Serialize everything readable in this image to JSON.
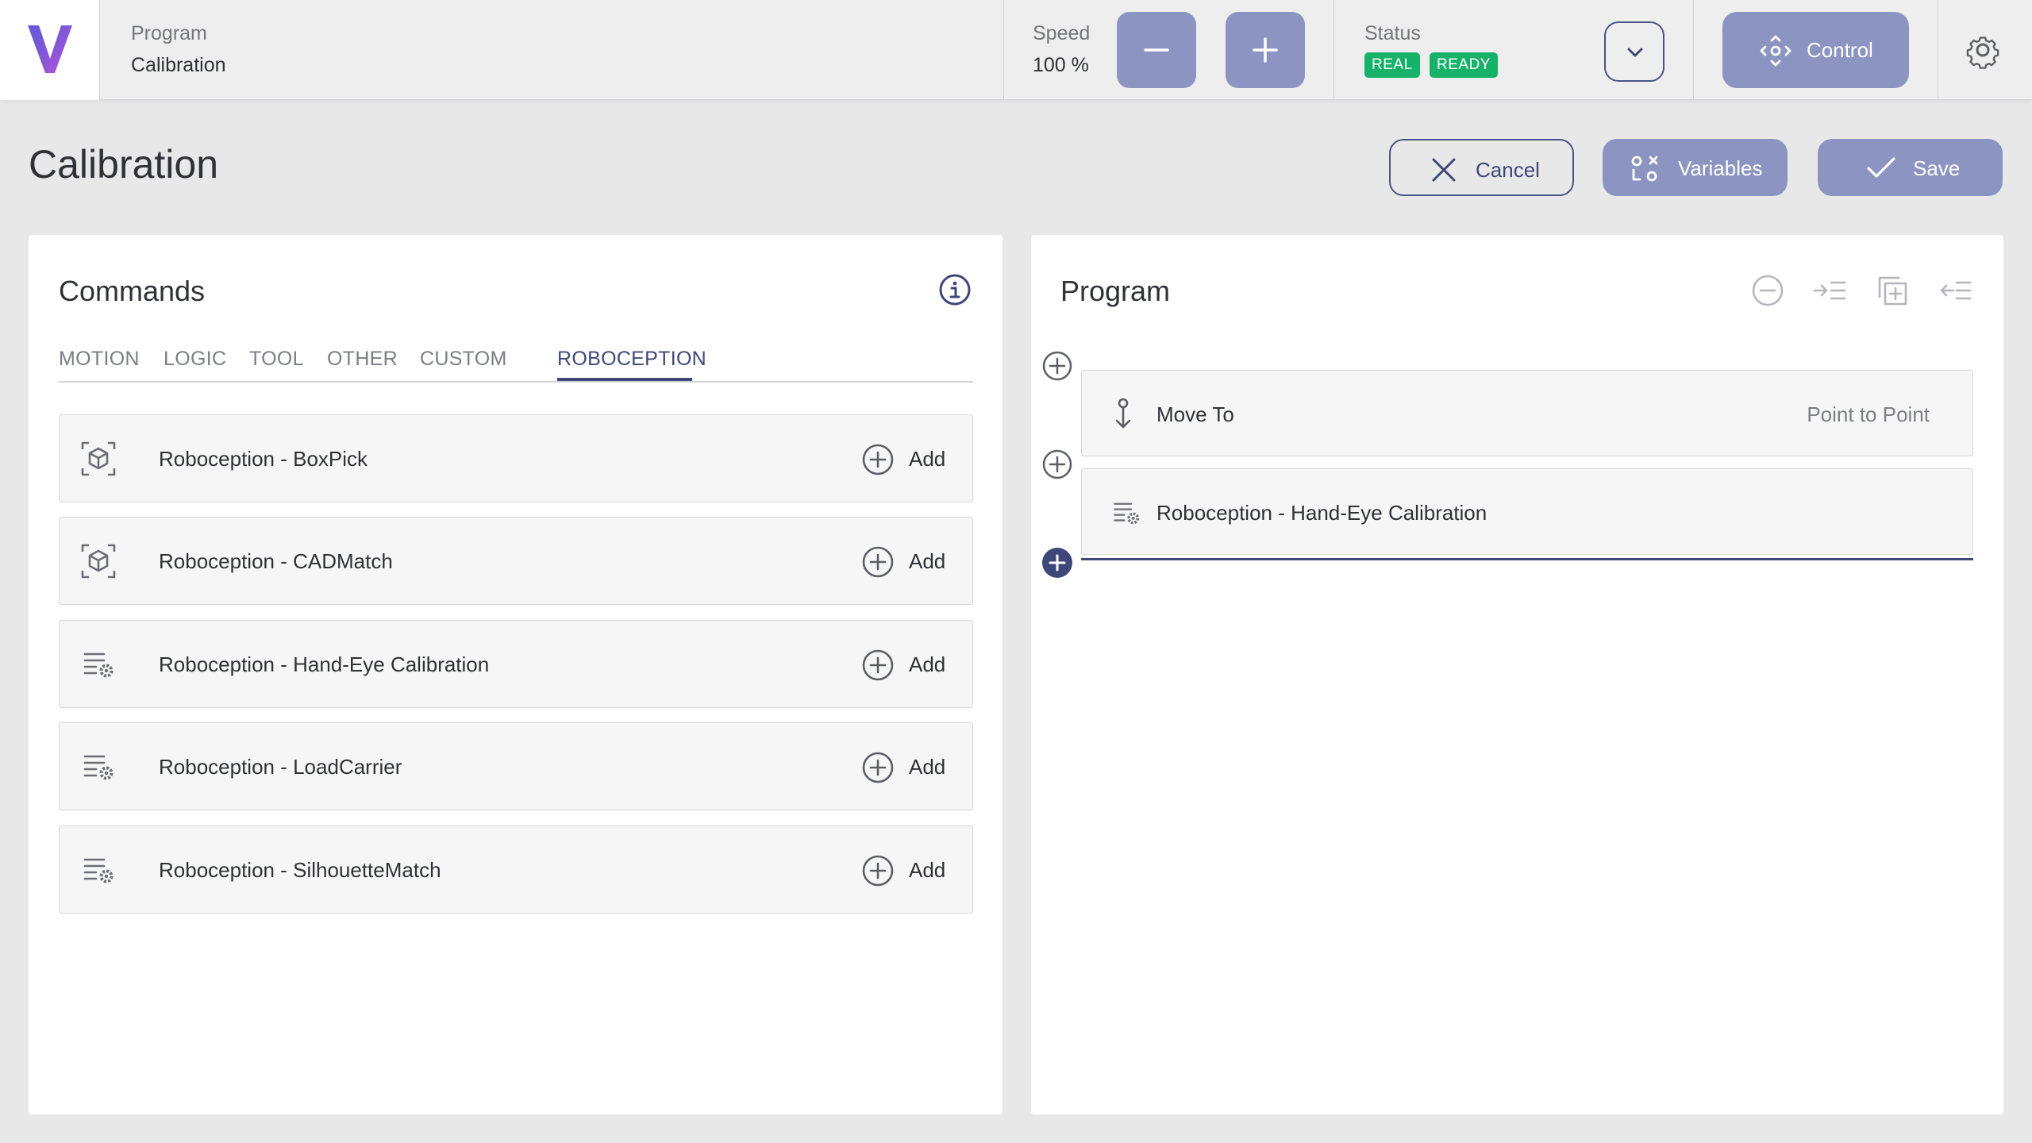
{
  "topbar": {
    "program_label": "Program",
    "program_name": "Calibration",
    "speed_label": "Speed",
    "speed_value": "100 %",
    "status_label": "Status",
    "status_badges": [
      "REAL",
      "READY"
    ],
    "control_label": "Control"
  },
  "header": {
    "title": "Calibration",
    "cancel_label": "Cancel",
    "variables_label": "Variables",
    "save_label": "Save"
  },
  "commands": {
    "title": "Commands",
    "tabs": [
      "MOTION",
      "LOGIC",
      "TOOL",
      "OTHER",
      "CUSTOM",
      "ROBOCEPTION"
    ],
    "active_tab": "ROBOCEPTION",
    "add_label": "Add",
    "items": [
      {
        "label": "Roboception - BoxPick",
        "icon": "box-scan-icon"
      },
      {
        "label": "Roboception - CADMatch",
        "icon": "box-scan-icon"
      },
      {
        "label": "Roboception - Hand-Eye Calibration",
        "icon": "list-settings-icon"
      },
      {
        "label": "Roboception - LoadCarrier",
        "icon": "list-settings-icon"
      },
      {
        "label": "Roboception - SilhouetteMatch",
        "icon": "list-settings-icon"
      }
    ]
  },
  "program": {
    "title": "Program",
    "steps": [
      {
        "label": "Move To",
        "detail": "Point to Point",
        "icon": "move-to-icon"
      },
      {
        "label": "Roboception - Hand-Eye Calibration",
        "detail": "",
        "icon": "list-settings-icon"
      }
    ]
  },
  "colors": {
    "accent": "#3e4779",
    "button_fill": "#8c95c2",
    "status_green": "#17b26a",
    "background": "#e8e8e9"
  }
}
